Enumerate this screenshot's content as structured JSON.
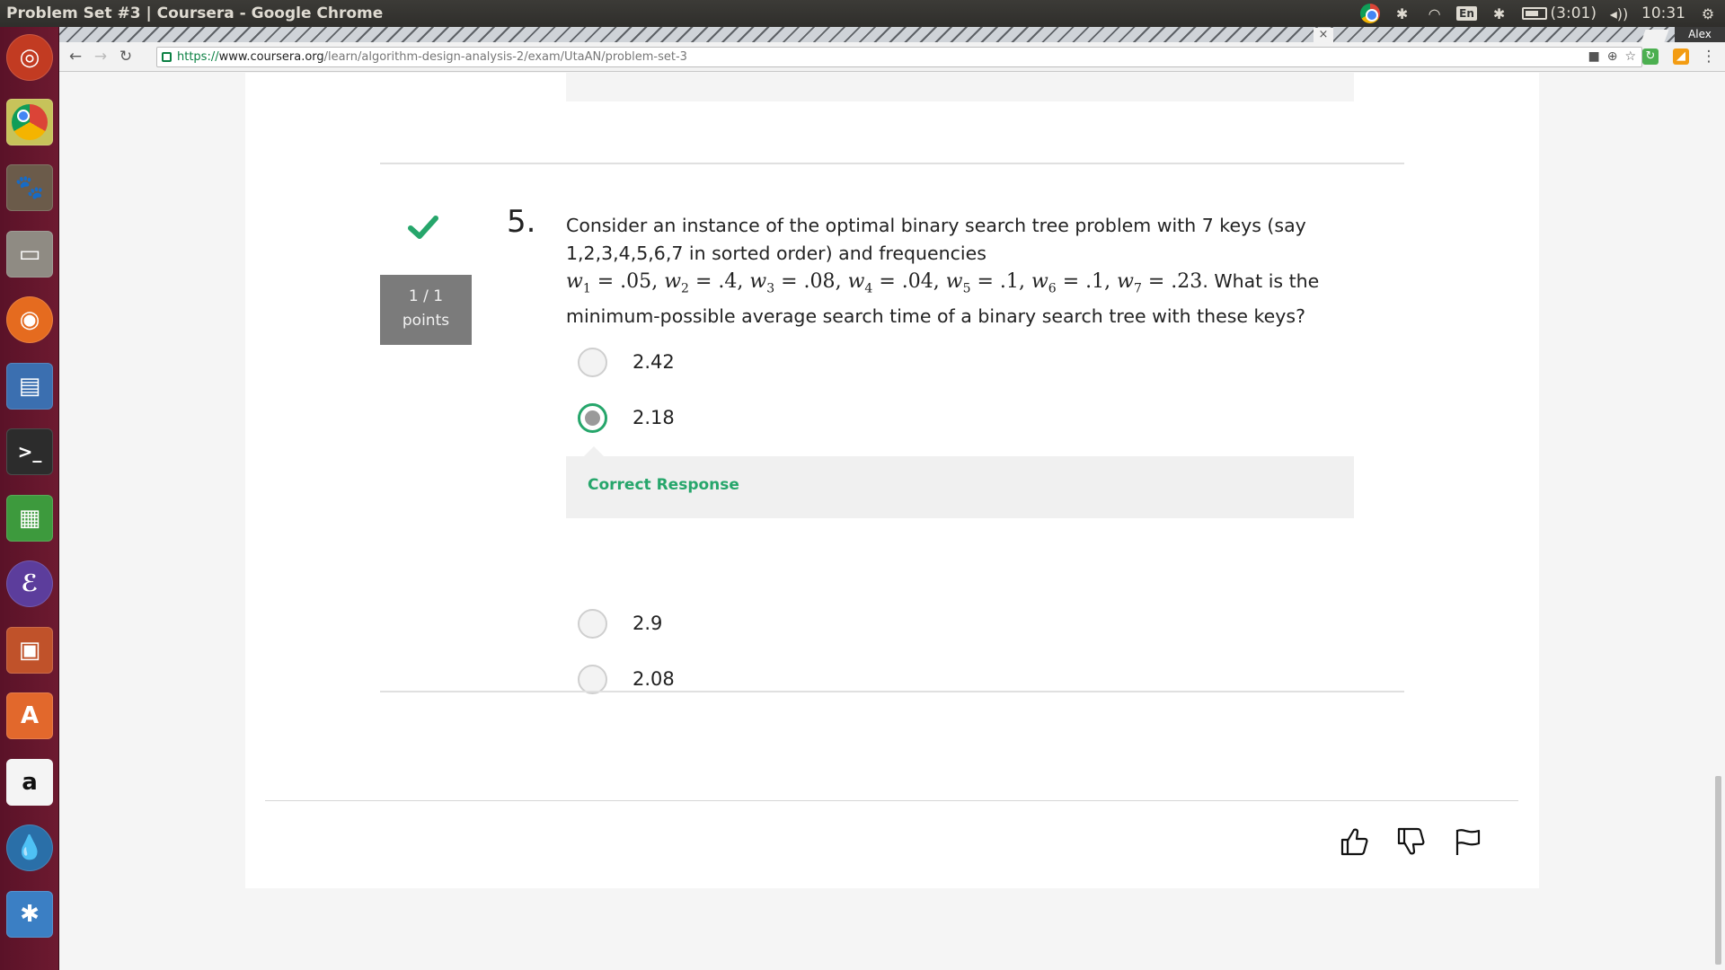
{
  "os_bar": {
    "window_title": "Problem Set #3 | Coursera - Google Chrome",
    "battery_text": "(3:01)",
    "keyboard_layout": "En",
    "clock": "10:31"
  },
  "browser": {
    "tab_close_glyph": "×",
    "user_name": "Alex",
    "url_https": "https://",
    "url_host": "www.coursera.org",
    "url_path": "/learn/algorithm-design-analysis-2/exam/UtaAN/problem-set-3"
  },
  "launcher": {
    "apps": [
      "ubuntu-dash-icon",
      "chrome-icon",
      "gimp-icon",
      "files-icon",
      "firefox-icon",
      "image-viewer-icon",
      "terminal-icon",
      "spreadsheet-icon",
      "emacs-icon",
      "presentation-icon",
      "software-center-icon",
      "amazon-icon",
      "drop-icon",
      "bluetooth-icon"
    ]
  },
  "question": {
    "number": "5.",
    "score_line1": "1 / 1",
    "score_line2": "points",
    "text_part1": "Consider an instance of the optimal binary search tree problem with 7 keys (say 1,2,3,4,5,6,7 in sorted order) and frequencies",
    "text_part2": ". What is the minimum-possible average search time of a binary search tree with these keys?",
    "frequencies": [
      {
        "var": "w",
        "sub": "1",
        "val": ".05"
      },
      {
        "var": "w",
        "sub": "2",
        "val": ".4"
      },
      {
        "var": "w",
        "sub": "3",
        "val": ".08"
      },
      {
        "var": "w",
        "sub": "4",
        "val": ".04"
      },
      {
        "var": "w",
        "sub": "5",
        "val": ".1"
      },
      {
        "var": "w",
        "sub": "6",
        "val": ".1"
      },
      {
        "var": "w",
        "sub": "7",
        "val": ".23"
      }
    ],
    "options": [
      {
        "label": "2.42",
        "selected": false
      },
      {
        "label": "2.18",
        "selected": true
      },
      {
        "label": "2.9",
        "selected": false
      },
      {
        "label": "2.08",
        "selected": false
      }
    ],
    "feedback": "Correct Response"
  },
  "footer_icons": [
    "thumbs-up-icon",
    "thumbs-down-icon",
    "flag-icon"
  ],
  "colors": {
    "correct_green": "#26a66b",
    "score_box": "#7b7b7b",
    "launcher_bg": "#6d1a30"
  }
}
